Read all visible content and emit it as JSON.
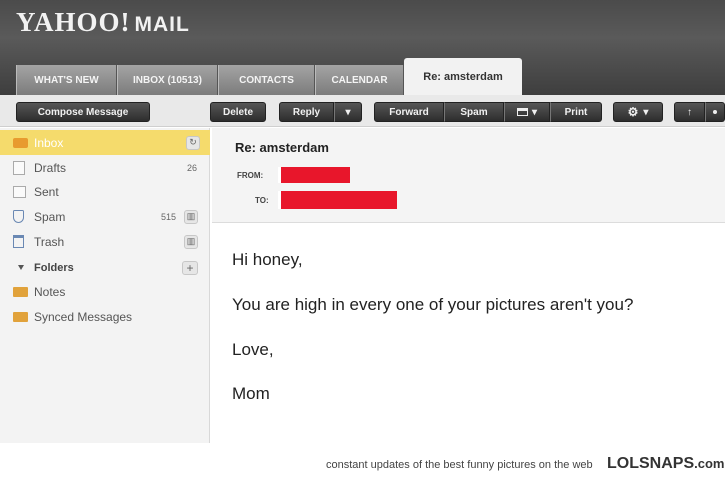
{
  "header": {
    "logo_text": "YAHOO!",
    "logo_sub": "MAIL"
  },
  "tabs": [
    {
      "label": "WHAT'S NEW"
    },
    {
      "label": "INBOX (10513)"
    },
    {
      "label": "CONTACTS"
    },
    {
      "label": "CALENDAR"
    },
    {
      "label": "Re: amsterdam",
      "active": true
    }
  ],
  "toolbar": {
    "compose": "Compose Message",
    "delete": "Delete",
    "reply": "Reply",
    "forward": "Forward",
    "spam": "Spam",
    "print": "Print",
    "dropdown_glyph": "▾",
    "up_glyph": "↑",
    "gear_glyph": "⚙"
  },
  "sidebar": {
    "folders": [
      {
        "label": "Inbox",
        "icon": "inbox-icon",
        "selected": true
      },
      {
        "label": "Drafts",
        "count": "26",
        "icon": "drafts-icon"
      },
      {
        "label": "Sent",
        "icon": "sent-icon"
      },
      {
        "label": "Spam",
        "count": "515",
        "icon": "shield-icon"
      },
      {
        "label": "Trash",
        "icon": "trash-icon"
      }
    ],
    "folders_header": "Folders",
    "custom_folders": [
      {
        "label": "Notes"
      },
      {
        "label": "Synced Messages"
      }
    ],
    "add_glyph": "+",
    "refresh_glyph": "↻",
    "empty_glyph": "▥"
  },
  "message": {
    "subject": "Re: amsterdam",
    "from_label": "FROM:",
    "to_label": "TO:",
    "body": [
      "Hi honey,",
      "You are high in every one of your pictures aren't you?",
      "Love,",
      "Mom"
    ]
  },
  "footer": {
    "tagline": "constant updates of the best funny pictures on the web",
    "brand": "LOLSNAPS",
    "brand_domain": ".com"
  },
  "colors": {
    "selected_folder": "#f5db6c",
    "redaction": "#e8162b",
    "header_bg": "#4b4b4b"
  }
}
